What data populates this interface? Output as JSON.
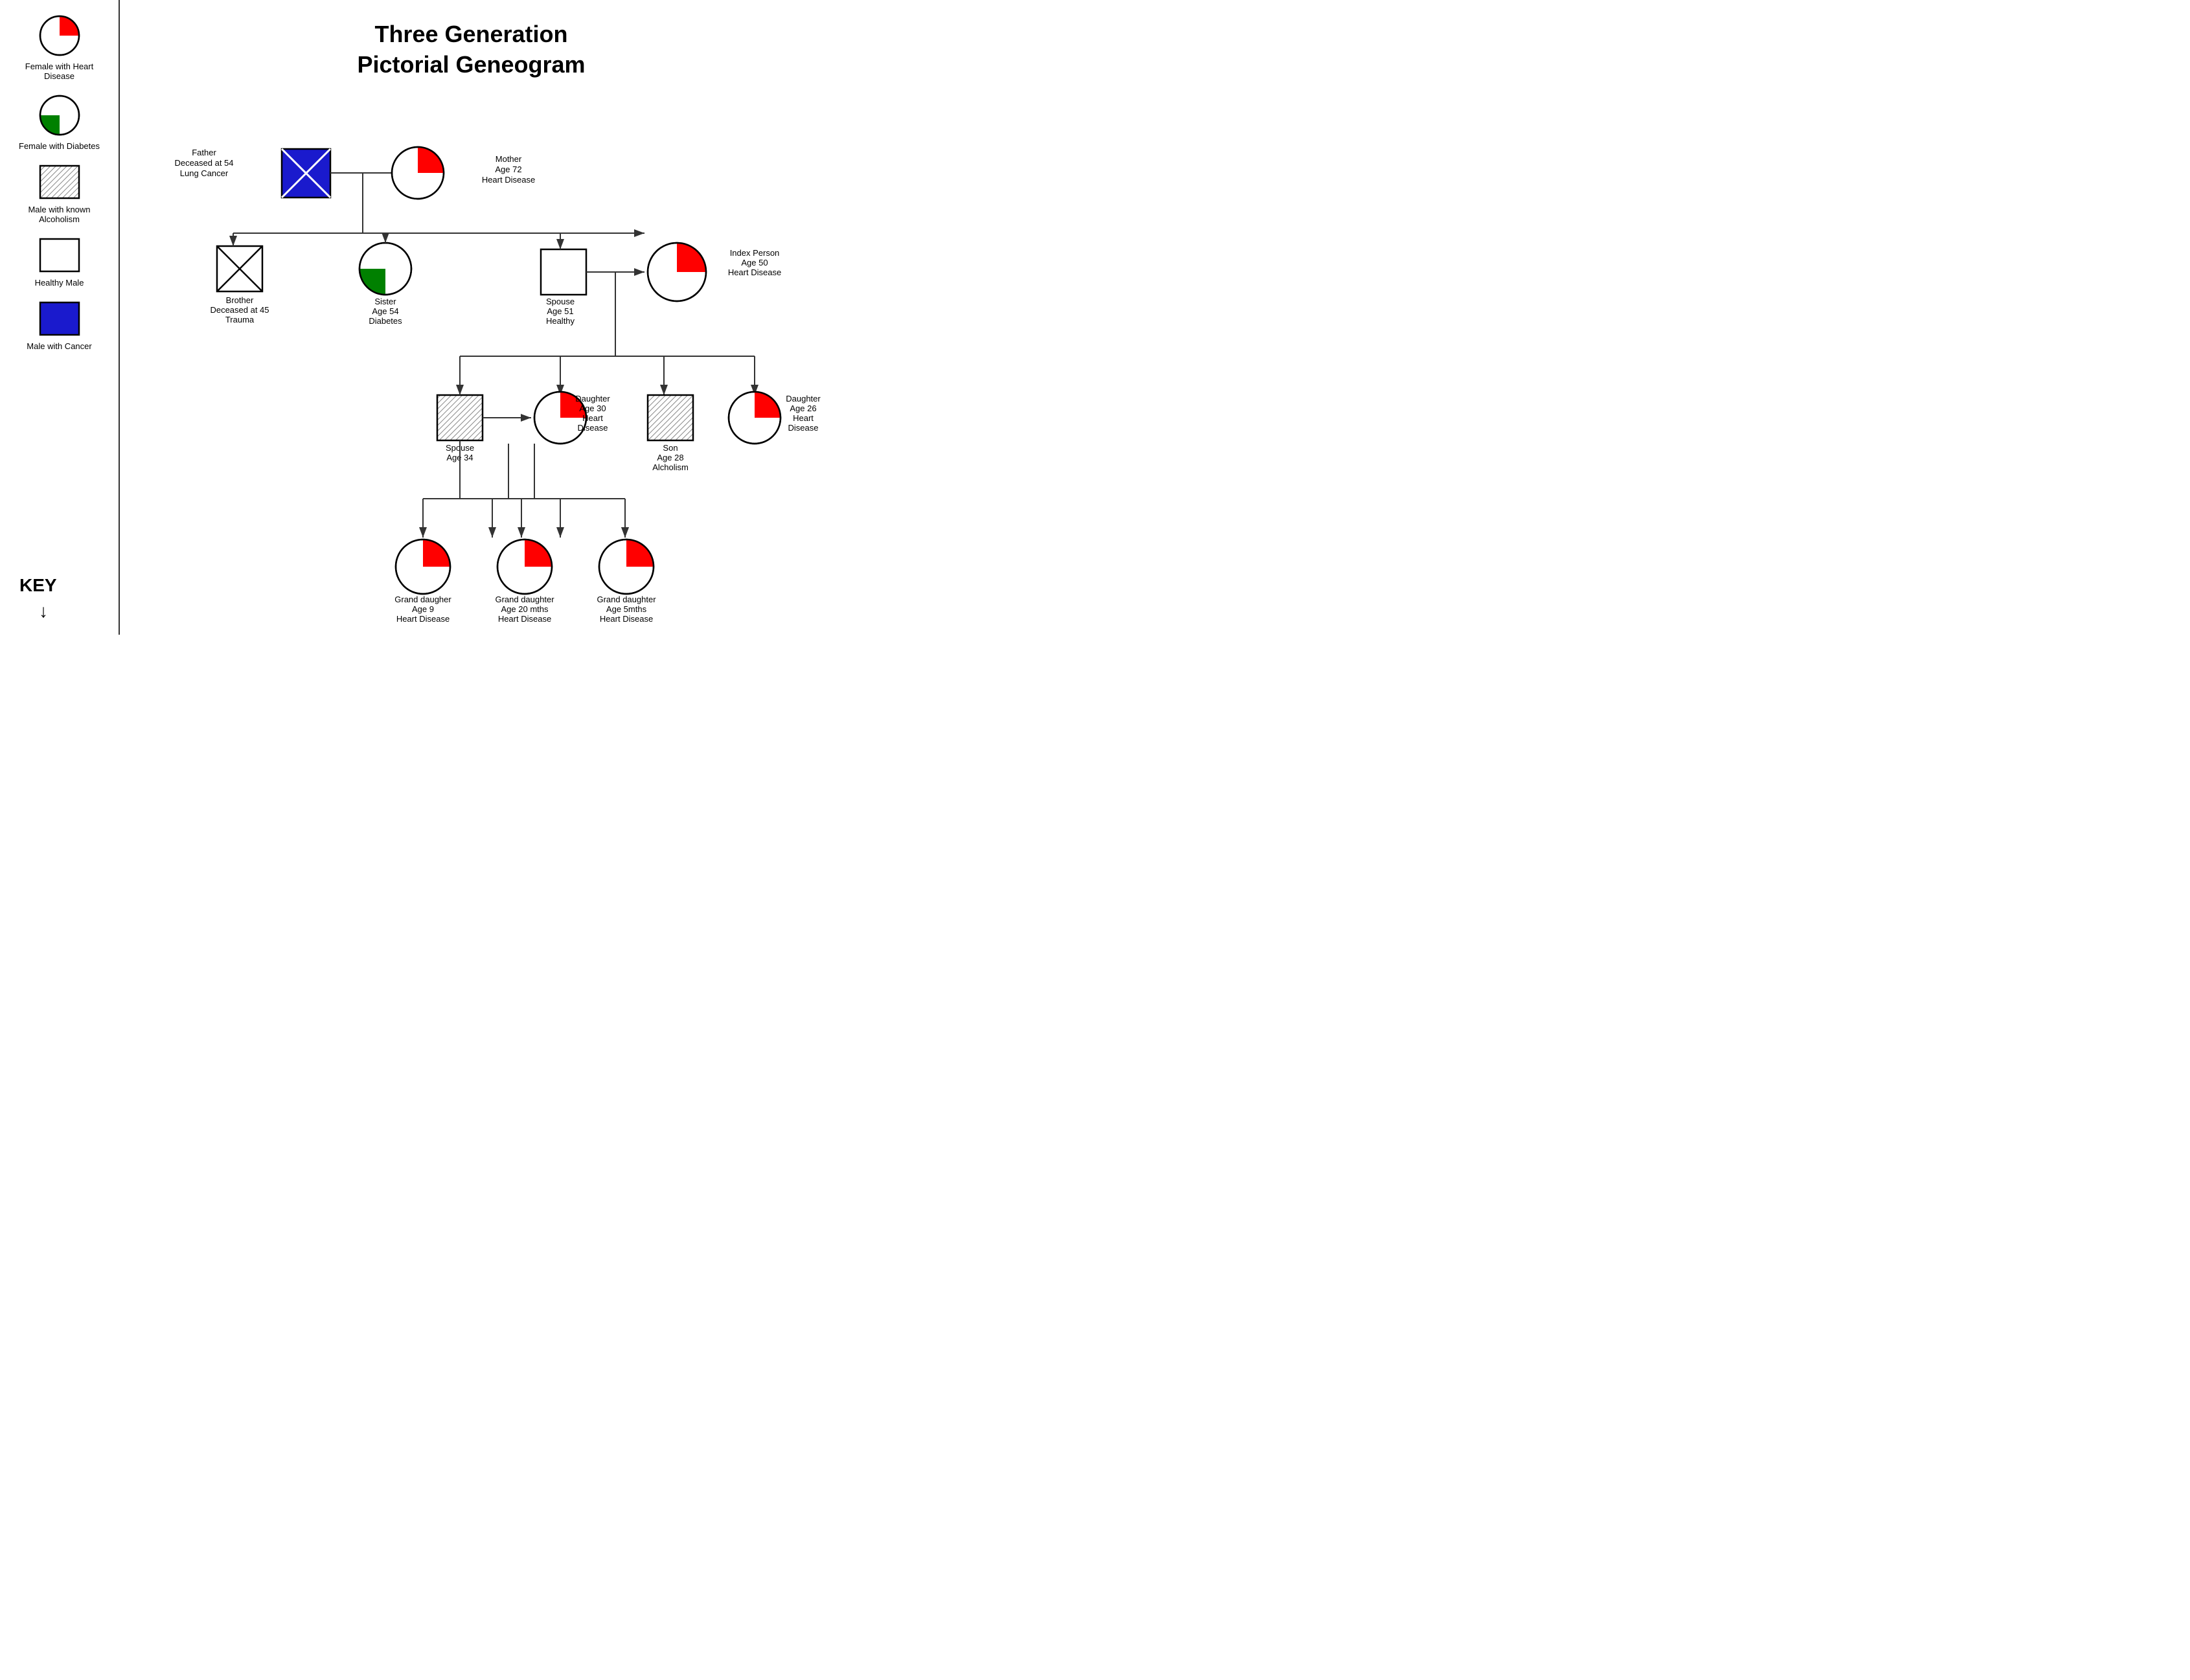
{
  "title": {
    "line1": "Three Generation",
    "line2": "Pictorial Geneogram"
  },
  "key": {
    "title": "KEY",
    "items": [
      {
        "id": "female-heart-disease",
        "label": "Female with\nHeart Disease",
        "type": "circle",
        "fill_sector": "red",
        "sector": "top-right"
      },
      {
        "id": "female-diabetes",
        "label": "Female with\nDiabetes",
        "type": "circle",
        "fill_sector": "green",
        "sector": "bottom-left"
      },
      {
        "id": "male-alcoholism",
        "label": "Male with known\nAlcoholism",
        "type": "square",
        "fill": "hatch"
      },
      {
        "id": "healthy-male",
        "label": "Healthy Male",
        "type": "square",
        "fill": "none"
      },
      {
        "id": "male-cancer",
        "label": "Male with\nCancer",
        "type": "square",
        "fill": "blue"
      }
    ]
  },
  "nodes": {
    "father": {
      "label": "Father\nDeceased at 54\nLung Cancer"
    },
    "mother": {
      "label": "Mother\nAge 72\nHeart Disease"
    },
    "brother": {
      "label": "Brother\nDeceased at 45\nTrauma"
    },
    "sister": {
      "label": "Sister\nAge 54\nDiabetes"
    },
    "spouse_gen2": {
      "label": "Spouse\nAge 51\nHealthy"
    },
    "index_person": {
      "label": "Index Person\nAge 50\nHeart Disease"
    },
    "spouse_gen3": {
      "label": "Spouse\nAge 34"
    },
    "daughter_gen3_1": {
      "label": "Daughter\nAge 30\nHeart\nDisease"
    },
    "son_gen3": {
      "label": "Son\nAge 28\nAlcholism"
    },
    "daughter_gen3_2": {
      "label": "Daughter\nAge 26\nHeart\nDisease"
    },
    "grand_daughter_1": {
      "label": "Grand daugher\nAge 9\nHeart Disease"
    },
    "grand_daughter_2": {
      "label": "Grand daughter\nAge 20 mths\nHeart Disease"
    },
    "grand_daughter_3": {
      "label": "Grand daughter\nAge 5mths\nHeart Disease"
    }
  }
}
